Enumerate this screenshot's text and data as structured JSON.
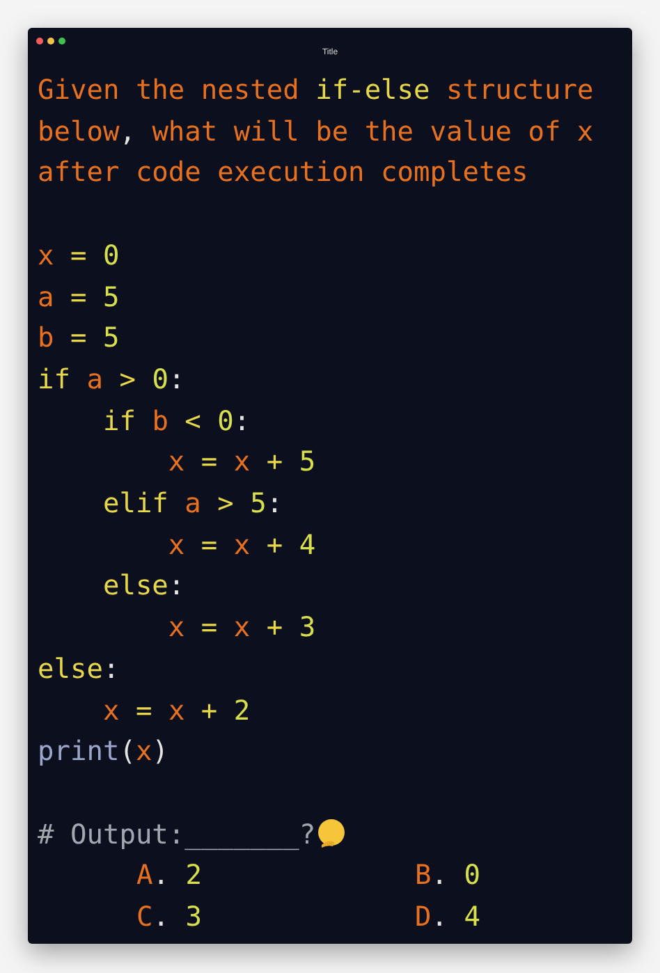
{
  "window": {
    "title": "Title"
  },
  "question": [
    {
      "kind": "var",
      "text": "Given the nested "
    },
    {
      "kind": "kw",
      "text": "if-else"
    },
    {
      "kind": "var",
      "text": " structure below"
    },
    {
      "kind": "punct",
      "text": ","
    },
    {
      "kind": "var",
      "text": " what will be the value of x after code execution completes"
    }
  ],
  "code": [
    [
      {
        "kind": "var",
        "text": "x"
      },
      {
        "kind": "op",
        "text": " = "
      },
      {
        "kind": "num",
        "text": "0"
      }
    ],
    [
      {
        "kind": "var",
        "text": "a"
      },
      {
        "kind": "op",
        "text": " = "
      },
      {
        "kind": "num",
        "text": "5"
      }
    ],
    [
      {
        "kind": "var",
        "text": "b"
      },
      {
        "kind": "op",
        "text": " = "
      },
      {
        "kind": "num",
        "text": "5"
      }
    ],
    [
      {
        "kind": "kw",
        "text": "if "
      },
      {
        "kind": "var",
        "text": "a"
      },
      {
        "kind": "op",
        "text": " > "
      },
      {
        "kind": "num",
        "text": "0"
      },
      {
        "kind": "punct",
        "text": ":"
      }
    ],
    [
      {
        "kind": "kw",
        "text": "    if "
      },
      {
        "kind": "var",
        "text": "b"
      },
      {
        "kind": "op",
        "text": " < "
      },
      {
        "kind": "num",
        "text": "0"
      },
      {
        "kind": "punct",
        "text": ":"
      }
    ],
    [
      {
        "kind": "var",
        "text": "        x"
      },
      {
        "kind": "op",
        "text": " = "
      },
      {
        "kind": "var",
        "text": "x"
      },
      {
        "kind": "op",
        "text": " + "
      },
      {
        "kind": "num",
        "text": "5"
      }
    ],
    [
      {
        "kind": "kw",
        "text": "    elif "
      },
      {
        "kind": "var",
        "text": "a"
      },
      {
        "kind": "op",
        "text": " > "
      },
      {
        "kind": "num",
        "text": "5"
      },
      {
        "kind": "punct",
        "text": ":"
      }
    ],
    [
      {
        "kind": "var",
        "text": "        x"
      },
      {
        "kind": "op",
        "text": " = "
      },
      {
        "kind": "var",
        "text": "x"
      },
      {
        "kind": "op",
        "text": " + "
      },
      {
        "kind": "num",
        "text": "4"
      }
    ],
    [
      {
        "kind": "kw",
        "text": "    else"
      },
      {
        "kind": "punct",
        "text": ":"
      }
    ],
    [
      {
        "kind": "var",
        "text": "        x"
      },
      {
        "kind": "op",
        "text": " = "
      },
      {
        "kind": "var",
        "text": "x"
      },
      {
        "kind": "op",
        "text": " + "
      },
      {
        "kind": "num",
        "text": "3"
      }
    ],
    [
      {
        "kind": "kw",
        "text": "else"
      },
      {
        "kind": "punct",
        "text": ":"
      }
    ],
    [
      {
        "kind": "var",
        "text": "    x"
      },
      {
        "kind": "op",
        "text": " = "
      },
      {
        "kind": "var",
        "text": "x"
      },
      {
        "kind": "op",
        "text": " + "
      },
      {
        "kind": "num",
        "text": "2"
      }
    ],
    [
      {
        "kind": "fn",
        "text": "print"
      },
      {
        "kind": "punct",
        "text": "("
      },
      {
        "kind": "var",
        "text": "x"
      },
      {
        "kind": "punct",
        "text": ")"
      }
    ]
  ],
  "output_prompt": [
    {
      "kind": "comment",
      "text": "# Output:_______?"
    }
  ],
  "options": [
    [
      {
        "kind": "var",
        "text": "A"
      },
      {
        "kind": "punct",
        "text": ". "
      },
      {
        "kind": "num",
        "text": "2"
      }
    ],
    [
      {
        "kind": "var",
        "text": "B"
      },
      {
        "kind": "punct",
        "text": ". "
      },
      {
        "kind": "num",
        "text": "0"
      }
    ],
    [
      {
        "kind": "var",
        "text": "C"
      },
      {
        "kind": "punct",
        "text": ". "
      },
      {
        "kind": "num",
        "text": "3"
      }
    ],
    [
      {
        "kind": "var",
        "text": "D"
      },
      {
        "kind": "punct",
        "text": ". "
      },
      {
        "kind": "num",
        "text": "4"
      }
    ]
  ]
}
